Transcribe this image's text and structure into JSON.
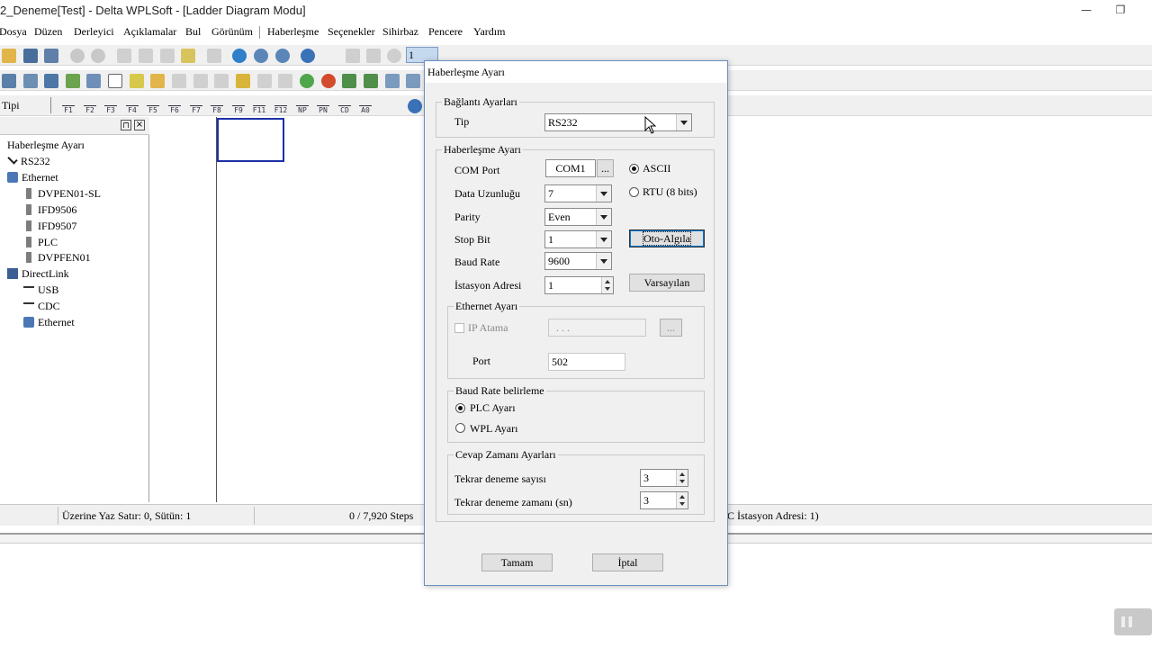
{
  "window": {
    "title": "2_Deneme[Test] - Delta WPLSoft - [Ladder Diagram Modu]",
    "minimize_glyph": "—",
    "restore_glyph": "❐"
  },
  "menu": [
    "Dosya",
    "Düzen",
    "Derleyici",
    "Açıklamalar",
    "Bul",
    "Görünüm",
    "Haberleşme",
    "Seçenekler",
    "Sihirbaz",
    "Pencere",
    "Yardım"
  ],
  "toolbar": {
    "step_value": "1",
    "fkeys": [
      {
        "top": "",
        "bottom": "F1"
      },
      {
        "top": "",
        "bottom": "F2"
      },
      {
        "top": "",
        "bottom": "F3"
      },
      {
        "top": "",
        "bottom": "F4"
      },
      {
        "top": "",
        "bottom": "F5"
      },
      {
        "top": "",
        "bottom": "F6"
      },
      {
        "top": "",
        "bottom": "F7"
      },
      {
        "top": "",
        "bottom": "F8"
      },
      {
        "top": "",
        "bottom": "F9"
      },
      {
        "top": "",
        "bottom": "F11"
      },
      {
        "top": "",
        "bottom": "F12"
      },
      {
        "top": "",
        "bottom": "NP"
      },
      {
        "top": "",
        "bottom": "PN"
      },
      {
        "top": "",
        "bottom": "CD"
      },
      {
        "top": "",
        "bottom": "A0"
      }
    ]
  },
  "tipi_label": "Tipi",
  "tree": {
    "root": "Haberleşme Ayarı",
    "items": [
      {
        "label": "RS232",
        "icon": "checkmark-icon",
        "indent": 1
      },
      {
        "label": "Ethernet",
        "icon": "network-icon",
        "indent": 1
      },
      {
        "label": "DVPEN01-SL",
        "icon": "device-icon",
        "indent": 2
      },
      {
        "label": "IFD9506",
        "icon": "device-icon",
        "indent": 2
      },
      {
        "label": "IFD9507",
        "icon": "device-icon",
        "indent": 2
      },
      {
        "label": "PLC",
        "icon": "device-icon",
        "indent": 2
      },
      {
        "label": "DVPFEN01",
        "icon": "device-icon",
        "indent": 2
      },
      {
        "label": "DirectLink",
        "icon": "directlink-icon",
        "indent": 1
      },
      {
        "label": "USB",
        "icon": "usb-icon",
        "indent": 2
      },
      {
        "label": "CDC",
        "icon": "usb-icon",
        "indent": 2
      },
      {
        "label": "Ethernet",
        "icon": "network-icon",
        "indent": 2
      }
    ]
  },
  "status": {
    "mode": "Üzerine Yaz",
    "position": "Satır: 0, Sütün: 1",
    "steps": "0 / 7,920 Steps",
    "station": "C İstasyon Adresi: 1)"
  },
  "dialog": {
    "title": "Haberleşme Ayarı",
    "connection_group": "Bağlantı Ayarları",
    "type_label": "Tip",
    "type_value": "RS232",
    "comm_group": "Haberleşme Ayarı",
    "com_port_label": "COM Port",
    "com_port_value": "COM1",
    "browse_label": "...",
    "ascii_label": "ASCII",
    "rtu_label": "RTU (8 bits)",
    "mode_selected": "ASCII",
    "data_length_label": "Data Uzunluğu",
    "data_length_value": "7",
    "parity_label": "Parity",
    "parity_value": "Even",
    "stop_bit_label": "Stop Bit",
    "stop_bit_value": "1",
    "auto_detect_label": "Oto-Algıla",
    "baud_rate_label": "Baud Rate",
    "baud_rate_value": "9600",
    "station_label": "İstasyon Adresi",
    "station_value": "1",
    "defaults_label": "Varsayılan",
    "ethernet_group": "Ethernet Ayarı",
    "ip_label": "IP Atama",
    "ip_value": ".   .   .",
    "ip_browse": "...",
    "port_label": "Port",
    "port_value": "502",
    "baud_group": "Baud Rate belirleme",
    "plc_label": "PLC Ayarı",
    "wpl_label": "WPL Ayarı",
    "baud_selected": "PLC Ayarı",
    "response_group": "Cevap Zamanı Ayarları",
    "retry_count_label": "Tekrar deneme sayısı",
    "retry_count_value": "3",
    "retry_time_label": "Tekrar deneme zamanı (sn)",
    "retry_time_value": "3",
    "ok_label": "Tamam",
    "cancel_label": "İptal"
  },
  "colors": {
    "selection_border": "#1c2fa8",
    "dialog_border": "#6b8fbf"
  }
}
